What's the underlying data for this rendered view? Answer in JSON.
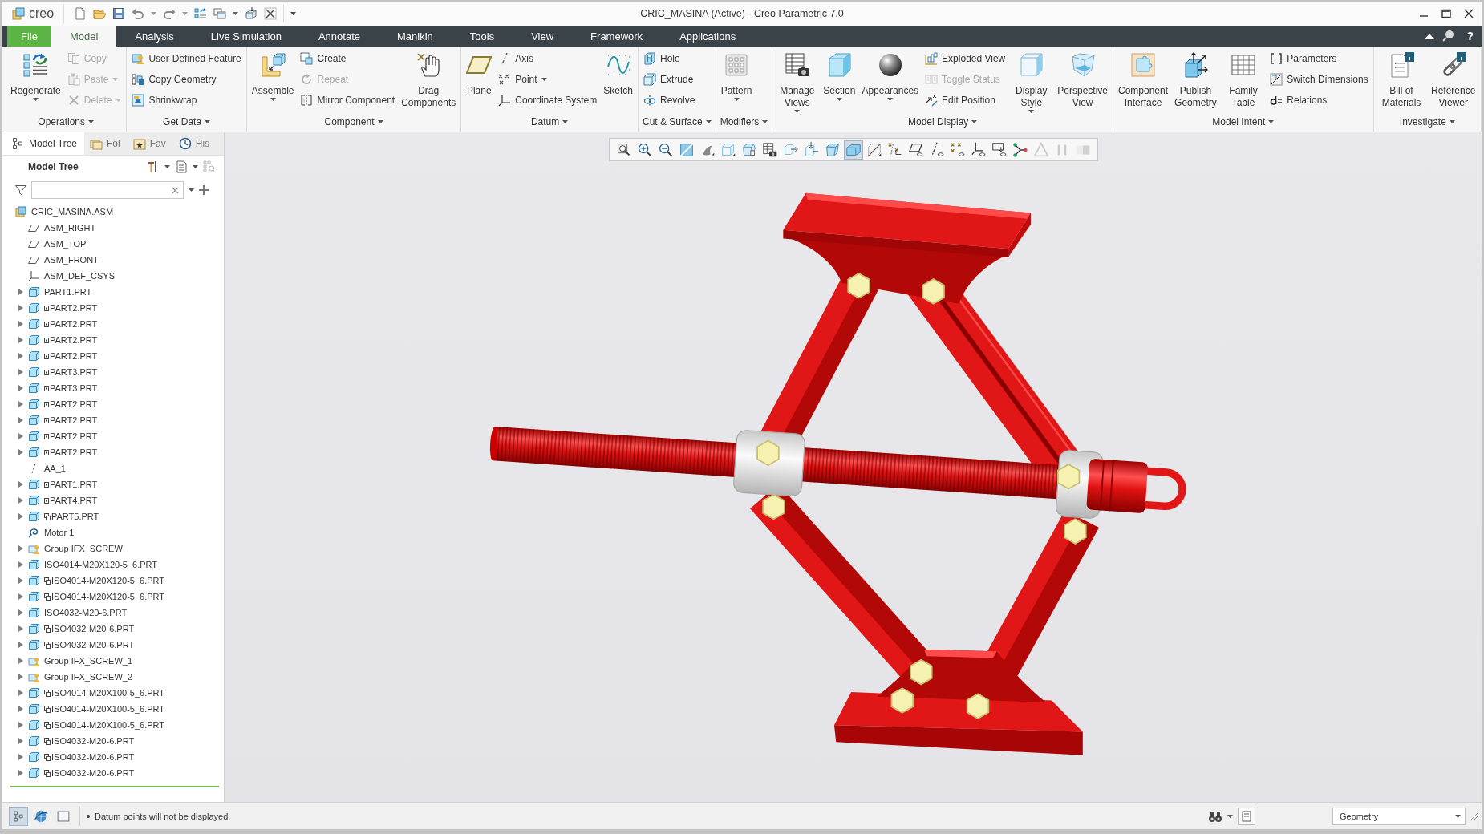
{
  "window": {
    "logo": "creo",
    "title": "CRIC_MASINA (Active) - Creo Parametric 7.0"
  },
  "tabs": [
    {
      "label": "File",
      "kind": "file",
      "selected": false
    },
    {
      "label": "Model",
      "kind": "tab",
      "selected": true
    },
    {
      "label": "Analysis",
      "kind": "tab",
      "selected": false
    },
    {
      "label": "Live Simulation",
      "kind": "tab",
      "selected": false
    },
    {
      "label": "Annotate",
      "kind": "tab",
      "selected": false
    },
    {
      "label": "Manikin",
      "kind": "tab",
      "selected": false
    },
    {
      "label": "Tools",
      "kind": "tab",
      "selected": false
    },
    {
      "label": "View",
      "kind": "tab",
      "selected": false
    },
    {
      "label": "Framework",
      "kind": "tab",
      "selected": false
    },
    {
      "label": "Applications",
      "kind": "tab",
      "selected": false
    }
  ],
  "help": "?",
  "ribbon": [
    {
      "label": "Operations",
      "columns": [
        [
          {
            "label": "Regenerate",
            "kind": "large",
            "dropdown": true,
            "disabled": false
          }
        ],
        [
          {
            "label": "Copy",
            "kind": "small",
            "dropdown": false,
            "disabled": true
          },
          {
            "label": "Paste",
            "kind": "small",
            "dropdown": true,
            "disabled": true
          },
          {
            "label": "Delete",
            "kind": "small",
            "dropdown": true,
            "disabled": true
          }
        ]
      ]
    },
    {
      "label": "Get Data",
      "columns": [
        [
          {
            "label": "User-Defined Feature",
            "kind": "small",
            "dropdown": false,
            "disabled": false
          },
          {
            "label": "Copy Geometry",
            "kind": "small",
            "dropdown": false,
            "disabled": false
          },
          {
            "label": "Shrinkwrap",
            "kind": "small",
            "dropdown": false,
            "disabled": false
          }
        ]
      ]
    },
    {
      "label": "Component",
      "columns": [
        [
          {
            "label": "Assemble",
            "kind": "large",
            "dropdown": true,
            "disabled": false
          }
        ],
        [
          {
            "label": "Create",
            "kind": "small",
            "dropdown": false,
            "disabled": false
          },
          {
            "label": "Repeat",
            "kind": "small",
            "dropdown": false,
            "disabled": true
          },
          {
            "label": "Mirror Component",
            "kind": "small",
            "dropdown": false,
            "disabled": false
          }
        ],
        [
          {
            "label": "Drag Components",
            "kind": "large",
            "dropdown": false,
            "disabled": false
          }
        ]
      ]
    },
    {
      "label": "Datum",
      "columns": [
        [
          {
            "label": "Plane",
            "kind": "large",
            "dropdown": false,
            "disabled": false
          }
        ],
        [
          {
            "label": "Axis",
            "kind": "small",
            "dropdown": false,
            "disabled": false
          },
          {
            "label": "Point",
            "kind": "small",
            "dropdown": true,
            "disabled": false
          },
          {
            "label": "Coordinate System",
            "kind": "small",
            "dropdown": false,
            "disabled": false
          }
        ],
        [
          {
            "label": "Sketch",
            "kind": "large",
            "dropdown": false,
            "disabled": false
          }
        ]
      ]
    },
    {
      "label": "Cut & Surface",
      "columns": [
        [
          {
            "label": "Hole",
            "kind": "small",
            "dropdown": false,
            "disabled": false
          },
          {
            "label": "Extrude",
            "kind": "small",
            "dropdown": false,
            "disabled": false
          },
          {
            "label": "Revolve",
            "kind": "small",
            "dropdown": false,
            "disabled": false
          }
        ]
      ]
    },
    {
      "label": "Modifiers",
      "columns": [
        [
          {
            "label": "Pattern",
            "kind": "large",
            "dropdown": true,
            "disabled": false
          }
        ]
      ]
    },
    {
      "label": "Model Display",
      "columns": [
        [
          {
            "label": "Manage Views",
            "kind": "large",
            "dropdown": true,
            "disabled": false
          }
        ],
        [
          {
            "label": "Section",
            "kind": "large",
            "dropdown": true,
            "disabled": false
          }
        ],
        [
          {
            "label": "Appearances",
            "kind": "large",
            "dropdown": true,
            "disabled": false
          }
        ],
        [
          {
            "label": "Exploded View",
            "kind": "small",
            "dropdown": false,
            "disabled": false
          },
          {
            "label": "Toggle Status",
            "kind": "small",
            "dropdown": false,
            "disabled": true
          },
          {
            "label": "Edit Position",
            "kind": "small",
            "dropdown": false,
            "disabled": false
          }
        ],
        [
          {
            "label": "Display Style",
            "kind": "large",
            "dropdown": true,
            "disabled": false
          }
        ],
        [
          {
            "label": "Perspective View",
            "kind": "large",
            "dropdown": false,
            "disabled": false
          }
        ]
      ]
    },
    {
      "label": "Model Intent",
      "columns": [
        [
          {
            "label": "Component Interface",
            "kind": "large",
            "dropdown": false,
            "disabled": false
          }
        ],
        [
          {
            "label": "Publish Geometry",
            "kind": "large",
            "dropdown": false,
            "disabled": false
          }
        ],
        [
          {
            "label": "Family Table",
            "kind": "large",
            "dropdown": false,
            "disabled": false
          }
        ],
        [
          {
            "label": "Parameters",
            "kind": "small",
            "dropdown": false,
            "disabled": false
          },
          {
            "label": "Switch Dimensions",
            "kind": "small",
            "dropdown": false,
            "disabled": false
          },
          {
            "label": "Relations",
            "kind": "small",
            "dropdown": false,
            "disabled": false
          }
        ]
      ]
    },
    {
      "label": "Investigate",
      "columns": [
        [
          {
            "label": "Bill of Materials",
            "kind": "large",
            "dropdown": false,
            "disabled": false
          }
        ],
        [
          {
            "label": "Reference Viewer",
            "kind": "large",
            "dropdown": false,
            "disabled": false
          }
        ]
      ]
    }
  ],
  "panel_tabs": [
    {
      "label": "Model Tree",
      "selected": true
    },
    {
      "label": "Fol",
      "selected": false
    },
    {
      "label": "Fav",
      "selected": false
    },
    {
      "label": "His",
      "selected": false
    }
  ],
  "model_tree": {
    "title": "Model Tree",
    "items": [
      {
        "label": "CRIC_MASINA.ASM",
        "kind": "assembly",
        "expandable": false,
        "children": [
          {
            "label": "ASM_RIGHT",
            "kind": "plane",
            "expandable": false
          },
          {
            "label": "ASM_TOP",
            "kind": "plane",
            "expandable": false
          },
          {
            "label": "ASM_FRONT",
            "kind": "plane",
            "expandable": false
          },
          {
            "label": "ASM_DEF_CSYS",
            "kind": "csys",
            "expandable": false
          },
          {
            "label": "PART1.PRT",
            "kind": "part",
            "expandable": true,
            "expanded": false,
            "square_mark": false,
            "copy_mark": false
          },
          {
            "label": "PART2.PRT",
            "kind": "part",
            "expandable": true,
            "expanded": false,
            "square_mark": true,
            "copy_mark": false
          },
          {
            "label": "PART2.PRT",
            "kind": "part",
            "expandable": true,
            "expanded": false,
            "square_mark": true,
            "copy_mark": false
          },
          {
            "label": "PART2.PRT",
            "kind": "part",
            "expandable": true,
            "expanded": false,
            "square_mark": true,
            "copy_mark": false
          },
          {
            "label": "PART2.PRT",
            "kind": "part",
            "expandable": true,
            "expanded": false,
            "square_mark": true,
            "copy_mark": false
          },
          {
            "label": "PART3.PRT",
            "kind": "part",
            "expandable": true,
            "expanded": false,
            "square_mark": true,
            "copy_mark": false
          },
          {
            "label": "PART3.PRT",
            "kind": "part",
            "expandable": true,
            "expanded": false,
            "square_mark": true,
            "copy_mark": false
          },
          {
            "label": "PART2.PRT",
            "kind": "part",
            "expandable": true,
            "expanded": false,
            "square_mark": true,
            "copy_mark": false
          },
          {
            "label": "PART2.PRT",
            "kind": "part",
            "expandable": true,
            "expanded": false,
            "square_mark": true,
            "copy_mark": false
          },
          {
            "label": "PART2.PRT",
            "kind": "part",
            "expandable": true,
            "expanded": false,
            "square_mark": true,
            "copy_mark": false
          },
          {
            "label": "PART2.PRT",
            "kind": "part",
            "expandable": true,
            "expanded": false,
            "square_mark": true,
            "copy_mark": false
          },
          {
            "label": "AA_1",
            "kind": "axis",
            "expandable": false
          },
          {
            "label": "PART1.PRT",
            "kind": "part",
            "expandable": true,
            "expanded": false,
            "square_mark": true,
            "copy_mark": false
          },
          {
            "label": "PART4.PRT",
            "kind": "part",
            "expandable": true,
            "expanded": false,
            "square_mark": true,
            "copy_mark": false
          },
          {
            "label": "PART5.PRT",
            "kind": "part",
            "expandable": true,
            "expanded": false,
            "square_mark": false,
            "copy_mark": true
          },
          {
            "label": "Motor 1",
            "kind": "motor",
            "expandable": false
          },
          {
            "label": "Group IFX_SCREW",
            "kind": "group",
            "expandable": true,
            "expanded": false
          },
          {
            "label": "ISO4014-M20X120-5_6.PRT",
            "kind": "part",
            "expandable": true,
            "expanded": false,
            "square_mark": false,
            "copy_mark": false
          },
          {
            "label": "ISO4014-M20X120-5_6.PRT",
            "kind": "part",
            "expandable": true,
            "expanded": false,
            "square_mark": false,
            "copy_mark": true
          },
          {
            "label": "ISO4014-M20X120-5_6.PRT",
            "kind": "part",
            "expandable": true,
            "expanded": false,
            "square_mark": false,
            "copy_mark": true
          },
          {
            "label": "ISO4032-M20-6.PRT",
            "kind": "part",
            "expandable": true,
            "expanded": false,
            "square_mark": false,
            "copy_mark": false
          },
          {
            "label": "ISO4032-M20-6.PRT",
            "kind": "part",
            "expandable": true,
            "expanded": false,
            "square_mark": false,
            "copy_mark": true
          },
          {
            "label": "ISO4032-M20-6.PRT",
            "kind": "part",
            "expandable": true,
            "expanded": false,
            "square_mark": false,
            "copy_mark": true
          },
          {
            "label": "Group IFX_SCREW_1",
            "kind": "group",
            "expandable": true,
            "expanded": false
          },
          {
            "label": "Group IFX_SCREW_2",
            "kind": "group",
            "expandable": true,
            "expanded": false
          },
          {
            "label": "ISO4014-M20X100-5_6.PRT",
            "kind": "part",
            "expandable": true,
            "expanded": false,
            "square_mark": false,
            "copy_mark": true
          },
          {
            "label": "ISO4014-M20X100-5_6.PRT",
            "kind": "part",
            "expandable": true,
            "expanded": false,
            "square_mark": false,
            "copy_mark": true
          },
          {
            "label": "ISO4014-M20X100-5_6.PRT",
            "kind": "part",
            "expandable": true,
            "expanded": false,
            "square_mark": false,
            "copy_mark": true
          },
          {
            "label": "ISO4032-M20-6.PRT",
            "kind": "part",
            "expandable": true,
            "expanded": false,
            "square_mark": false,
            "copy_mark": true
          },
          {
            "label": "ISO4032-M20-6.PRT",
            "kind": "part",
            "expandable": true,
            "expanded": false,
            "square_mark": false,
            "copy_mark": true
          },
          {
            "label": "ISO4032-M20-6.PRT",
            "kind": "part",
            "expandable": true,
            "expanded": false,
            "square_mark": false,
            "copy_mark": true
          }
        ]
      }
    ]
  },
  "graphics_toolbar": [
    {
      "pressed": false,
      "disabled": false
    },
    {
      "pressed": false,
      "disabled": false
    },
    {
      "pressed": false,
      "disabled": false
    },
    {
      "pressed": false,
      "disabled": false
    },
    {
      "pressed": false,
      "disabled": false
    },
    {
      "pressed": false,
      "disabled": false
    },
    {
      "pressed": false,
      "disabled": false
    },
    {
      "pressed": false,
      "disabled": false
    },
    {
      "pressed": false,
      "disabled": false
    },
    {
      "pressed": false,
      "disabled": false
    },
    {
      "pressed": false,
      "disabled": false
    },
    {
      "pressed": true,
      "disabled": false
    },
    {
      "pressed": false,
      "disabled": false
    },
    {
      "pressed": false,
      "disabled": false
    },
    {
      "pressed": false,
      "disabled": false
    },
    {
      "pressed": false,
      "disabled": false
    },
    {
      "pressed": false,
      "disabled": false
    },
    {
      "pressed": false,
      "disabled": false
    },
    {
      "pressed": false,
      "disabled": false
    },
    {
      "pressed": false,
      "disabled": false
    },
    {
      "pressed": false,
      "disabled": true
    },
    {
      "pressed": false,
      "disabled": true
    },
    {
      "pressed": false,
      "disabled": true
    }
  ],
  "status_bar": {
    "toggles": [
      {
        "pressed": true
      },
      {
        "pressed": false
      },
      {
        "pressed": false
      }
    ],
    "message": "Datum points will not be displayed.",
    "selection_filter": "Geometry"
  }
}
